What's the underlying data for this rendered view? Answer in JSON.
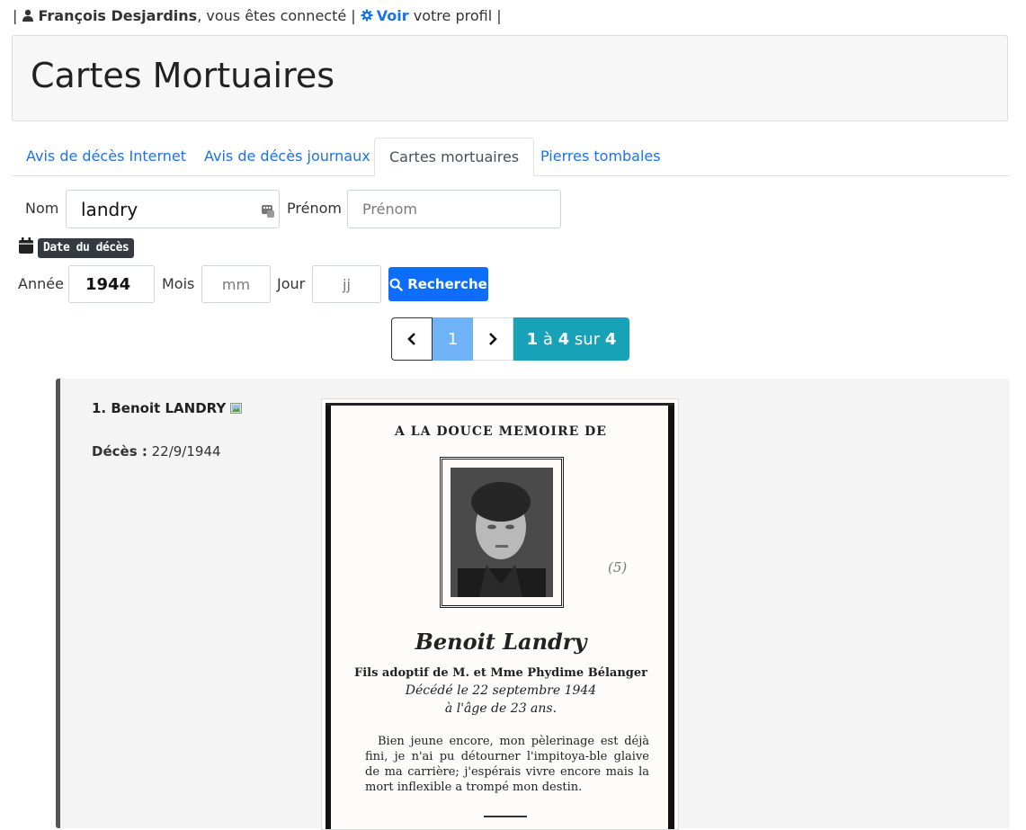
{
  "userbar": {
    "pipe_left": "|",
    "user_name": "François Desjardins",
    "connected": ", vous êtes connecté |",
    "link_label": "Voir",
    "link_suffix": "votre profil |"
  },
  "header": {
    "title": "Cartes Mortuaires"
  },
  "tabs": [
    {
      "label": "Avis de décès Internet"
    },
    {
      "label": "Avis de décès journaux"
    },
    {
      "label": "Cartes mortuaires"
    },
    {
      "label": "Pierres tombales"
    }
  ],
  "search": {
    "nom_label": "Nom",
    "nom_value": "landry",
    "prenom_label": "Prénom",
    "prenom_placeholder": "Prénom",
    "date_badge": "Date du décès",
    "annee_label": "Année",
    "annee_value": "1944",
    "mois_label": "Mois",
    "mois_placeholder": "mm",
    "jour_label": "Jour",
    "jour_placeholder": "jj",
    "button_label": "Recherche"
  },
  "pager": {
    "current": "1",
    "from": "1",
    "to_word": "à",
    "to": "4",
    "of_word": "sur",
    "total": "4"
  },
  "result": {
    "name": "1. Benoit LANDRY",
    "death_label": "Décès :",
    "death_date": "22/9/1944"
  },
  "card": {
    "heading": "A LA DOUCE MEMOIRE DE",
    "name": "Benoit Landry",
    "line1": "Fils adoptif de M. et Mme Phydime Bélanger",
    "line2": "Décédé le 22 septembre 1944",
    "line3": "à l'âge de 23 ans.",
    "text": "Bien jeune encore, mon pèlerinage est déjà fini, je n'ai pu détourner l'impitoya-ble glaive de ma carrière; j'espérais vivre encore mais la mort inflexible a trompé mon destin.",
    "annotation": "(5)"
  },
  "icons": {
    "user": "person-icon",
    "gear": "gear-icon",
    "calendar": "calendar-icon",
    "search": "search-icon",
    "prev": "chevron-left-icon",
    "next": "chevron-right-icon",
    "image": "image-icon",
    "keyboard": "keyboard-icon"
  },
  "colors": {
    "link": "#1a73e8",
    "primary": "#0d6efd",
    "info": "#17a2b8",
    "pager_active": "#6fb3f6"
  }
}
